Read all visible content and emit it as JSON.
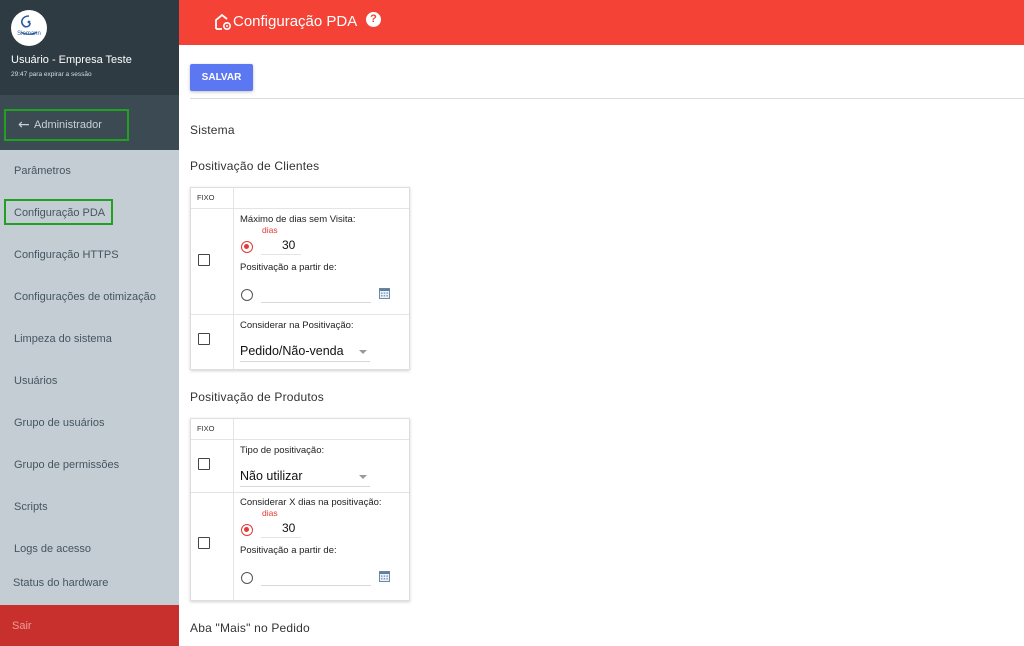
{
  "sidebar": {
    "logo_text": "Siemann",
    "user_name": "Usuário - Empresa Teste",
    "session_text": "29:47 para expirar a sessão",
    "admin_label": "Administrador",
    "items": [
      {
        "label": "Parâmetros"
      },
      {
        "label": "Configuração PDA"
      },
      {
        "label": "Configuração HTTPS"
      },
      {
        "label": "Configurações de otimização"
      },
      {
        "label": "Limpeza do sistema"
      },
      {
        "label": "Usuários"
      },
      {
        "label": "Grupo de usuários"
      },
      {
        "label": "Grupo de permissões"
      },
      {
        "label": "Scripts"
      },
      {
        "label": "Logs de acesso"
      },
      {
        "label": "Status do hardware"
      }
    ],
    "active_item": "Configuração PDA",
    "logout_label": "Sair"
  },
  "header": {
    "title": "Configuração PDA",
    "help_glyph": "?",
    "color": "#f44336"
  },
  "toolbar": {
    "save_label": "SALVAR",
    "save_color": "#5b78f2"
  },
  "main": {
    "sistema_title": "Sistema",
    "clientes": {
      "title": "Positivação de Clientes",
      "fixo_header": "FIXO",
      "max_dias_label": "Máximo de dias sem Visita:",
      "dias_unit": "dias",
      "max_dias_value": "30",
      "max_dias_selected": true,
      "a_partir_label": "Positivação a partir de:",
      "a_partir_selected": false,
      "considerar_label": "Considerar na Positivação:",
      "considerar_value": "Pedido/Não-venda",
      "row1_fixo": false,
      "row2_fixo": false
    },
    "produtos": {
      "title": "Positivação de Produtos",
      "fixo_header": "FIXO",
      "tipo_label": "Tipo de positivação:",
      "tipo_value": "Não utilizar",
      "considerar_label": "Considerar X dias na positivação:",
      "dias_unit": "dias",
      "dias_value": "30",
      "dias_selected": true,
      "a_partir_label": "Positivação a partir de:",
      "a_partir_selected": false,
      "row1_fixo": false,
      "row2_fixo": false
    },
    "aba_mais_title": "Aba \"Mais\" no Pedido"
  }
}
